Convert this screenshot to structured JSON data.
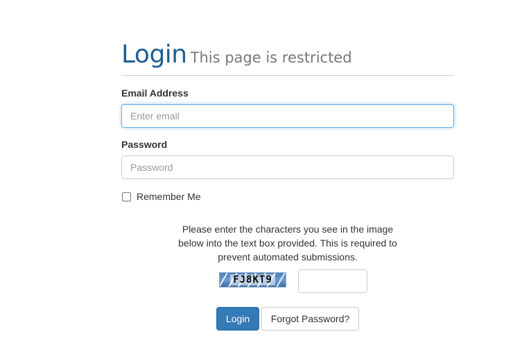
{
  "header": {
    "title": "Login",
    "subtitle": "This page is restricted"
  },
  "form": {
    "email_label": "Email Address",
    "email_placeholder": "Enter email",
    "email_value": "",
    "password_label": "Password",
    "password_placeholder": "Password",
    "password_value": "",
    "remember_label": "Remember Me",
    "remember_checked": false
  },
  "captcha": {
    "instructions": "Please enter the characters you see in the image below into the text box provided. This is required to prevent automated submissions.",
    "code": "FJ8KT9",
    "input_value": ""
  },
  "buttons": {
    "login_label": "Login",
    "forgot_label": "Forgot Password?"
  },
  "colors": {
    "title": "#1d5f93",
    "primary_button": "#337ab7",
    "focus_border": "#66afe9"
  }
}
